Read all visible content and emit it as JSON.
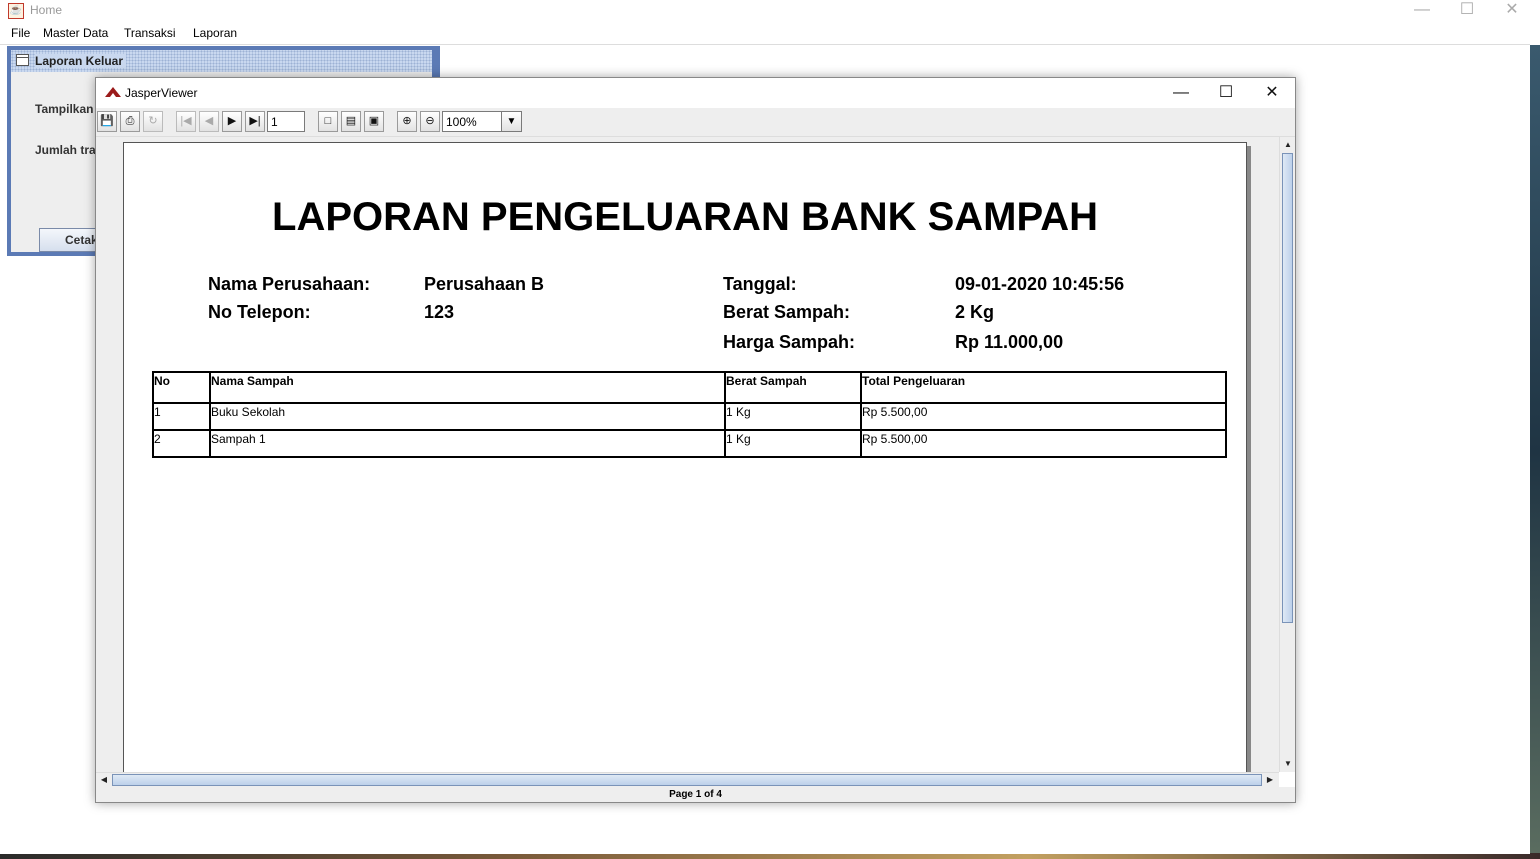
{
  "main_window": {
    "title": "Home",
    "menu": [
      "File",
      "Master Data",
      "Transaksi",
      "Laporan"
    ]
  },
  "internal_frame": {
    "title": "Laporan Keluar",
    "label_tampilkan": "Tampilkan",
    "label_jumlah": "Jumlah tra",
    "cetak_button": "Cetak"
  },
  "viewer": {
    "title": "JasperViewer",
    "page_input": "1",
    "zoom_value": "100%",
    "status": "Page 1 of 4"
  },
  "report": {
    "title": "LAPORAN PENGELUARAN BANK SAMPAH",
    "labels": {
      "nama_perusahaan": "Nama Perusahaan:",
      "no_telepon": "No Telepon:",
      "tanggal": "Tanggal:",
      "berat_sampah": "Berat Sampah:",
      "harga_sampah": "Harga Sampah:"
    },
    "values": {
      "nama_perusahaan": "Perusahaan B",
      "no_telepon": "123",
      "tanggal": "09-01-2020 10:45:56",
      "berat_sampah": "2 Kg",
      "harga_sampah": "Rp 11.000,00"
    },
    "table": {
      "headers": [
        "No",
        "Nama Sampah",
        "Berat Sampah",
        "Total Pengeluaran"
      ],
      "rows": [
        [
          "1",
          "Buku Sekolah",
          "1 Kg",
          "Rp 5.500,00"
        ],
        [
          "2",
          "Sampah 1",
          "1 Kg",
          "Rp 5.500,00"
        ]
      ]
    }
  },
  "colors": {
    "frame_border": "#5b7ab5",
    "frame_title": "#c9d8ef",
    "toolbar_bg": "#eeeeee"
  }
}
